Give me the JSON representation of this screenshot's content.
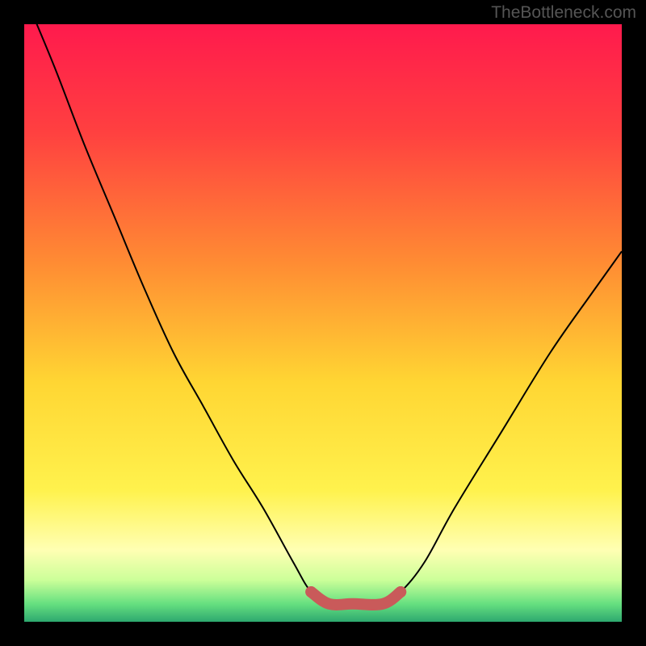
{
  "watermark": "TheBottleneck.com",
  "chart_data": {
    "type": "line",
    "title": "",
    "xlabel": "",
    "ylabel": "",
    "xlim": [
      0,
      1
    ],
    "ylim": [
      0,
      1
    ],
    "background": {
      "kind": "vertical_gradient",
      "stops": [
        {
          "pos": 0.0,
          "color": "#ff1a4d"
        },
        {
          "pos": 0.18,
          "color": "#ff4040"
        },
        {
          "pos": 0.4,
          "color": "#ff8c33"
        },
        {
          "pos": 0.6,
          "color": "#ffd633"
        },
        {
          "pos": 0.78,
          "color": "#fff24d"
        },
        {
          "pos": 0.88,
          "color": "#ffffb3"
        },
        {
          "pos": 0.93,
          "color": "#ccff99"
        },
        {
          "pos": 0.97,
          "color": "#66e080"
        },
        {
          "pos": 1.0,
          "color": "#2da86f"
        }
      ]
    },
    "series": [
      {
        "name": "curve",
        "color": "#000000",
        "x": [
          0.0,
          0.05,
          0.1,
          0.15,
          0.2,
          0.25,
          0.3,
          0.35,
          0.4,
          0.45,
          0.48,
          0.51,
          0.55,
          0.6,
          0.63,
          0.67,
          0.72,
          0.8,
          0.88,
          0.95,
          1.0
        ],
        "y": [
          1.05,
          0.93,
          0.8,
          0.68,
          0.56,
          0.45,
          0.36,
          0.27,
          0.19,
          0.1,
          0.05,
          0.03,
          0.03,
          0.03,
          0.05,
          0.1,
          0.19,
          0.32,
          0.45,
          0.55,
          0.62
        ]
      },
      {
        "name": "bottom_highlight",
        "color": "#c95a5a",
        "stroke_width": 14,
        "x": [
          0.48,
          0.51,
          0.55,
          0.6,
          0.63
        ],
        "y": [
          0.05,
          0.03,
          0.03,
          0.03,
          0.05
        ]
      }
    ]
  }
}
